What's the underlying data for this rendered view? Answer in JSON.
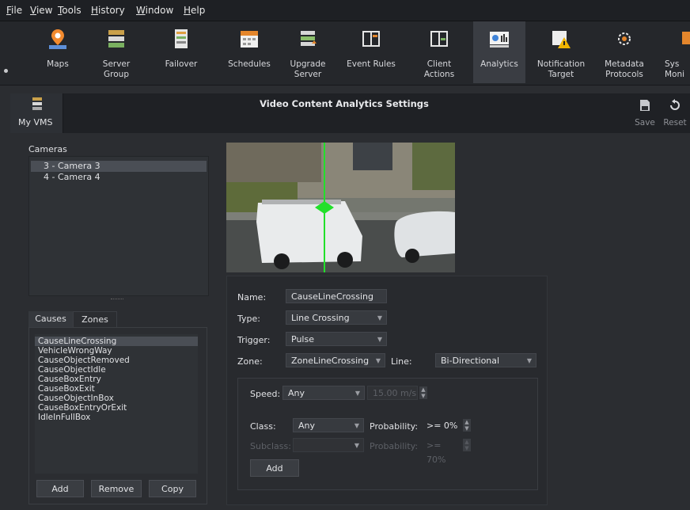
{
  "menu": [
    "File",
    "View",
    "Tools",
    "History",
    "Window",
    "Help"
  ],
  "ribbon": [
    {
      "label": "Maps",
      "icon": "map-pin-icon"
    },
    {
      "label": "Server Group",
      "icon": "server-group-icon"
    },
    {
      "label": "Failover",
      "icon": "failover-icon"
    },
    {
      "label": "Schedules",
      "icon": "calendar-icon"
    },
    {
      "label": "Upgrade\nServer",
      "icon": "upgrade-server-icon"
    },
    {
      "label": "Event Rules",
      "icon": "event-rules-icon"
    },
    {
      "label": "Client\nActions",
      "icon": "client-actions-icon"
    },
    {
      "label": "Analytics",
      "icon": "analytics-icon"
    },
    {
      "label": "Notification\nTarget",
      "icon": "notification-icon"
    },
    {
      "label": "Metadata\nProtocols",
      "icon": "metadata-icon"
    },
    {
      "label": "Sys\nMoni",
      "icon": "system-monitor-icon"
    }
  ],
  "header": {
    "tab": "My VMS",
    "title": "Video Content Analytics Settings",
    "save": "Save",
    "reset": "Reset"
  },
  "cameras": {
    "label": "Cameras",
    "items": [
      "3 - Camera 3",
      "4 - Camera 4"
    ],
    "selected": 0
  },
  "tabs": {
    "causes": "Causes",
    "zones": "Zones"
  },
  "causes": {
    "items": [
      "CauseLineCrossing",
      "VehicleWrongWay",
      "CauseObjectRemoved",
      "CauseObjectIdle",
      "CauseBoxEntry",
      "CauseBoxExit",
      "CauseObjectInBox",
      "CauseBoxEntryOrExit",
      "IdleInFullBox"
    ],
    "selected": 0
  },
  "buttons": {
    "add": "Add",
    "remove": "Remove",
    "copy": "Copy"
  },
  "form": {
    "name_label": "Name:",
    "name_value": "CauseLineCrossing",
    "type_label": "Type:",
    "type_value": "Line Crossing",
    "trigger_label": "Trigger:",
    "trigger_value": "Pulse",
    "zone_label": "Zone:",
    "zone_value": "ZoneLineCrossing",
    "line_label": "Line:",
    "line_value": "Bi-Directional",
    "speed_label": "Speed:",
    "speed_value": "Any",
    "speed_amount": "15.00 m/s",
    "class_label": "Class:",
    "class_value": "Any",
    "probability_label": "Probability:",
    "probability_value": ">= 0%",
    "subclass_label": "Subclass:",
    "subclass_value": "",
    "sub_probability_label": "Probability:",
    "sub_probability_value": ">= 70%",
    "add_label": "Add"
  },
  "colors": {
    "accent": "#3a3d43",
    "line": "#22e02a",
    "background": "#2b2d31"
  }
}
